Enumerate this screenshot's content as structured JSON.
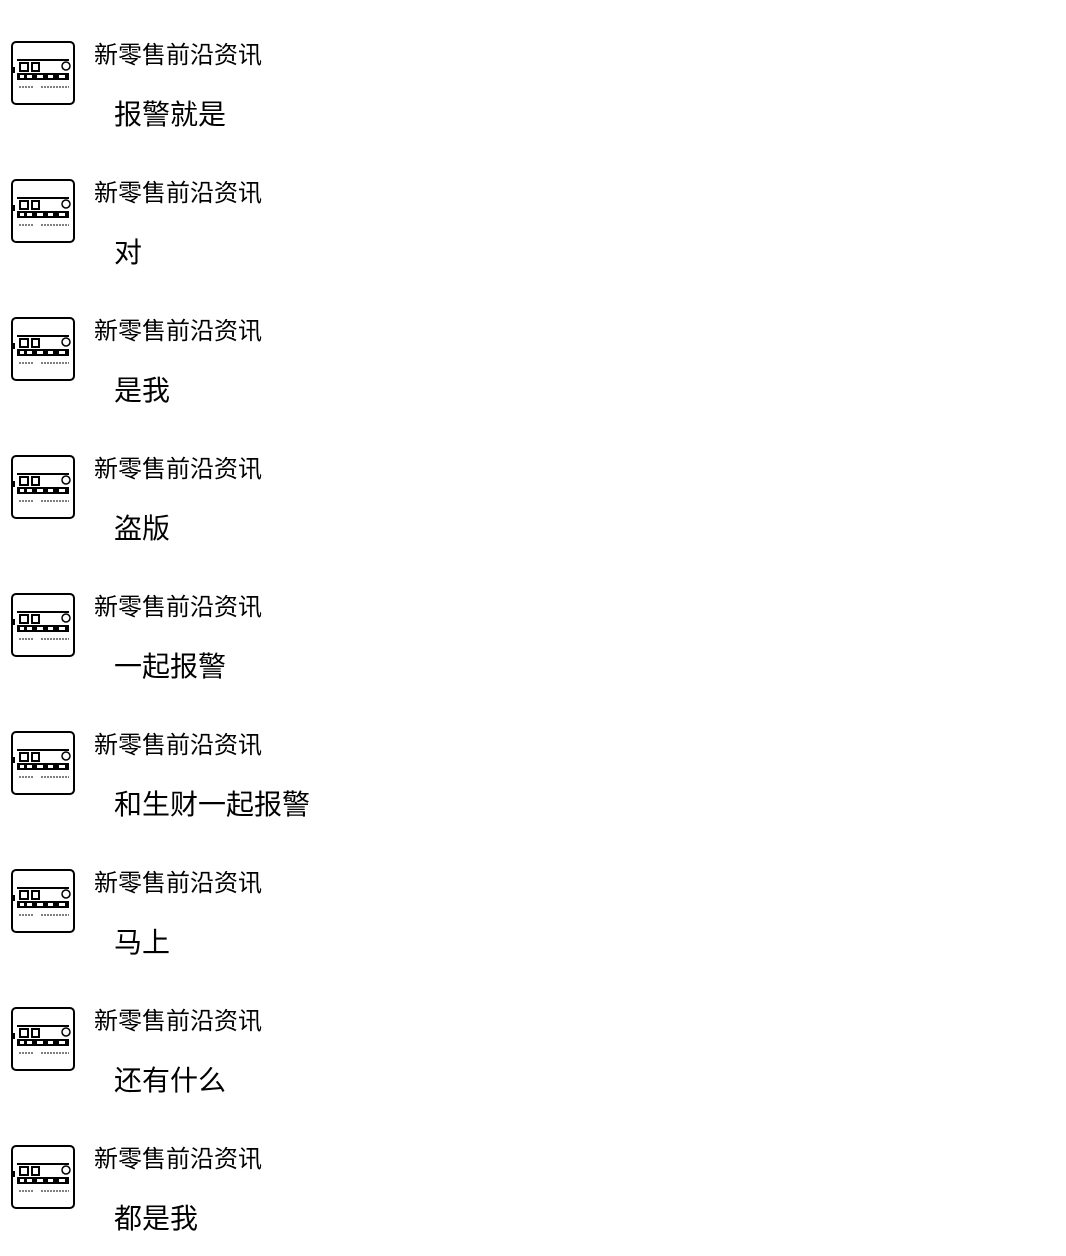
{
  "messages": [
    {
      "sender": "新零售前沿资讯",
      "avatar_icon": "brand-logo-icon",
      "text": "报警就是"
    },
    {
      "sender": "新零售前沿资讯",
      "avatar_icon": "brand-logo-icon",
      "text": "对"
    },
    {
      "sender": "新零售前沿资讯",
      "avatar_icon": "brand-logo-icon",
      "text": "是我"
    },
    {
      "sender": "新零售前沿资讯",
      "avatar_icon": "brand-logo-icon",
      "text": "盗版"
    },
    {
      "sender": "新零售前沿资讯",
      "avatar_icon": "brand-logo-icon",
      "text": "一起报警"
    },
    {
      "sender": "新零售前沿资讯",
      "avatar_icon": "brand-logo-icon",
      "text": "和生财一起报警"
    },
    {
      "sender": "新零售前沿资讯",
      "avatar_icon": "brand-logo-icon",
      "text": "马上"
    },
    {
      "sender": "新零售前沿资讯",
      "avatar_icon": "brand-logo-icon",
      "text": "还有什么"
    },
    {
      "sender": "新零售前沿资讯",
      "avatar_icon": "brand-logo-icon",
      "text": "都是我"
    }
  ]
}
